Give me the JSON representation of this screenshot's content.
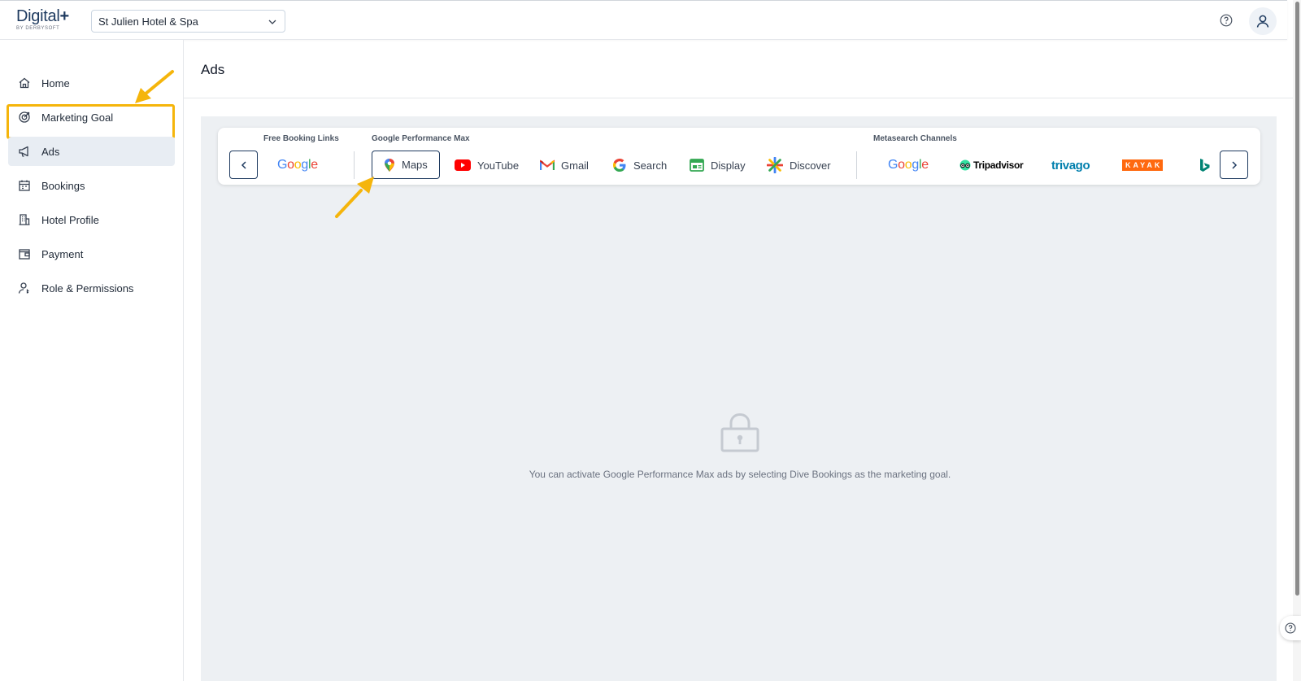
{
  "header": {
    "logo_text": "Digital",
    "logo_plus": "+",
    "logo_sub": "BY DERBYSOFT",
    "hotel_selected": "St Julien Hotel & Spa"
  },
  "sidebar": {
    "items": [
      {
        "label": "Home",
        "icon": "home-icon"
      },
      {
        "label": "Marketing Goal",
        "icon": "target-icon"
      },
      {
        "label": "Ads",
        "icon": "megaphone-icon"
      },
      {
        "label": "Bookings",
        "icon": "calendar-icon"
      },
      {
        "label": "Hotel Profile",
        "icon": "building-icon"
      },
      {
        "label": "Payment",
        "icon": "wallet-icon"
      },
      {
        "label": "Role & Permissions",
        "icon": "user-key-icon"
      }
    ],
    "active_item": "Ads",
    "highlighted_item": "Marketing Goal"
  },
  "main": {
    "title": "Ads",
    "groups": {
      "free_booking_links": "Free Booking Links",
      "google_performance_max": "Google Performance Max",
      "metasearch_channels": "Metasearch Channels"
    },
    "channels": {
      "maps": "Maps",
      "youtube": "YouTube",
      "gmail": "Gmail",
      "search": "Search",
      "display": "Display",
      "discover": "Discover"
    },
    "metasearch_logos": {
      "google": "Google",
      "tripadvisor": "Tripadvisor",
      "trivago": "trivago",
      "kayak": "KAYAK"
    },
    "selected_channel": "Maps",
    "empty_message": "You can activate Google Performance Max ads by selecting Dive Bookings as the marketing goal."
  },
  "colors": {
    "accent": "#1e3a5f",
    "highlight": "#f5b50b",
    "content_bg": "#edf0f3"
  }
}
